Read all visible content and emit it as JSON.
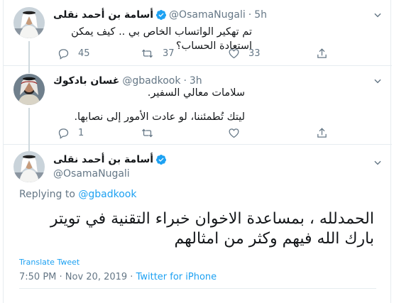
{
  "tweet1": {
    "name": "أسامة بن أحمد نقلى",
    "handle": "@OsamaNugali",
    "dot": "·",
    "time": "5h",
    "text": "تم تهكير الواتساب الخاص بي .. كيف يمكن استعادة الحساب؟",
    "replies": "45",
    "retweets": "37",
    "likes": "33"
  },
  "tweet2": {
    "name": "غسان بادكوك",
    "handle": "@gbadkook",
    "dot": "·",
    "time": "3h",
    "line1": "سلامات معالي السفير.",
    "line2": "ليتك تُطمئننا، لو عادت الأمور إلى نصابها.",
    "replies": "1"
  },
  "tweet3": {
    "name": "أسامة بن أحمد نقلى",
    "handle": "@OsamaNugali",
    "replying_prefix": "Replying to ",
    "replying_handle": "@gbadkook",
    "text": "الحمدلله ، بمساعدة الاخوان خبراء التقنية في تويتر بارك الله فيهم وكثر من امثالهم",
    "translate": "Translate Tweet",
    "timestamp": "7:50 PM · Nov 20, 2019 · ",
    "source": "Twitter for iPhone"
  },
  "colors": {
    "link": "#1da1f2",
    "muted": "#657786",
    "text": "#14171a"
  }
}
